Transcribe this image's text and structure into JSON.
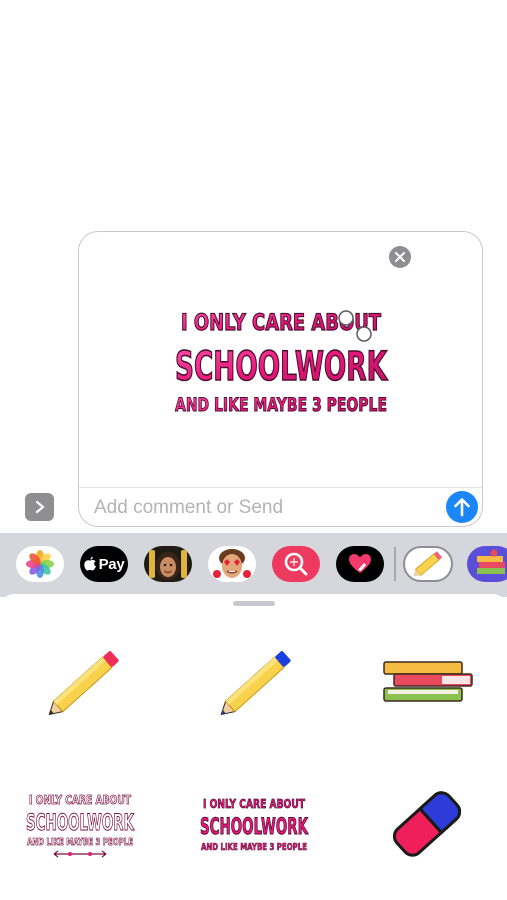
{
  "compose": {
    "placeholder": "Add comment or Send",
    "sticker": {
      "line1": "I ONLY CARE ABOUT",
      "line2": "SCHOOLWORK",
      "line3": "AND LIKE MAYBE 3 PEOPLE"
    }
  },
  "app_bar": {
    "items": [
      {
        "name": "photos",
        "icon": "photos-icon"
      },
      {
        "name": "apple-pay",
        "label": "Pay",
        "icon": "apple-logo-icon"
      },
      {
        "name": "memoji-girl",
        "icon": "memoji-icon"
      },
      {
        "name": "memoji-boy",
        "icon": "memoji-icon"
      },
      {
        "name": "search-images",
        "icon": "image-search-icon"
      },
      {
        "name": "digital-touch",
        "icon": "heart-hand-icon"
      },
      {
        "name": "pencil-stickers",
        "icon": "pencil-icon"
      },
      {
        "name": "school-stickers",
        "icon": "books-icon"
      }
    ]
  },
  "stickers": [
    {
      "name": "red-tip-pencil",
      "icon": "pencil-icon"
    },
    {
      "name": "blue-tip-pencil",
      "icon": "pencil-icon"
    },
    {
      "name": "stacked-books",
      "icon": "books-icon"
    },
    {
      "name": "schoolwork-text-white",
      "line1": "I ONLY CARE ABOUT",
      "line2": "SCHOOLWORK",
      "line3": "AND LIKE MAYBE 3 PEOPLE"
    },
    {
      "name": "schoolwork-text-pink",
      "line1": "I ONLY CARE ABOUT",
      "line2": "SCHOOLWORK",
      "line3": "AND LIKE MAYBE 3 PEOPLE"
    },
    {
      "name": "eraser",
      "icon": "eraser-icon"
    }
  ],
  "colors": {
    "accent_blue": "#1a86f7",
    "sticker_pink": "#e8177a",
    "sticker_outline": "#4a1030",
    "pencil_yellow": "#f8d24a",
    "drawer_gray": "#d5d7dc"
  }
}
